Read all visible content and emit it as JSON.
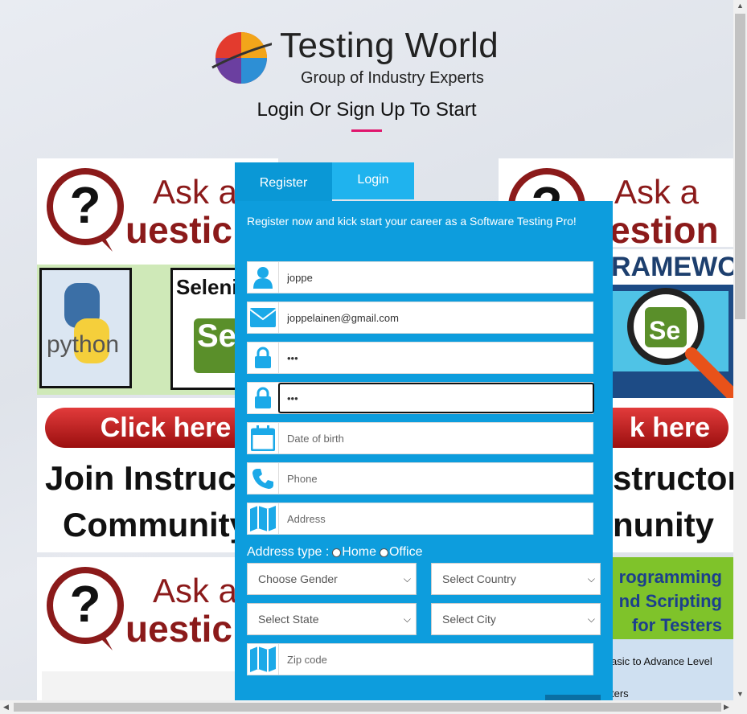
{
  "header": {
    "logo_title": "Testing World",
    "logo_subtitle": "Group of Industry Experts",
    "heading": "Login Or Sign Up To Start"
  },
  "tabs": [
    {
      "label": "Register"
    },
    {
      "label": "Login"
    }
  ],
  "intro_text": "Register now and kick start your career as a Software Testing Pro!",
  "fields": {
    "username": {
      "value": "joppe",
      "icon": "user-icon"
    },
    "email": {
      "value": "joppelainen@gmail.com",
      "icon": "envelope-icon"
    },
    "password": {
      "value": "•••",
      "icon": "lock-icon"
    },
    "confirm_password": {
      "value": "•••",
      "icon": "lock-icon"
    },
    "dob": {
      "placeholder": "Date of birth",
      "icon": "calendar-icon"
    },
    "phone": {
      "placeholder": "Phone",
      "icon": "phone-icon"
    },
    "address": {
      "placeholder": "Address",
      "icon": "map-icon"
    },
    "zip": {
      "placeholder": "Zip code",
      "icon": "map-icon"
    }
  },
  "address_type": {
    "label": "Address type :",
    "options": [
      "Home",
      "Office"
    ]
  },
  "selects": {
    "gender": "Choose Gender",
    "country": "Select Country",
    "state": "Select State",
    "city": "Select City"
  },
  "ads": {
    "ask_left": [
      "Ask a",
      "uestic"
    ],
    "ask_right": [
      "Ask a",
      "uestion"
    ],
    "python": "python",
    "selenium": "Seleniu",
    "framework": "RAMEWORK",
    "click_left": "Click here",
    "click_right": "k here",
    "join_left": [
      "Join Instruct",
      "Community"
    ],
    "join_right": [
      "structor",
      "nunity"
    ],
    "programming": [
      "rogramming",
      "nd Scripting",
      "for Testers"
    ],
    "basic": "asic to Advance Level",
    "ters": "ters"
  },
  "colors": {
    "panel": "#0d9ddd",
    "login_tab": "#1fb3ee",
    "accent_underline": "#e0166d"
  }
}
